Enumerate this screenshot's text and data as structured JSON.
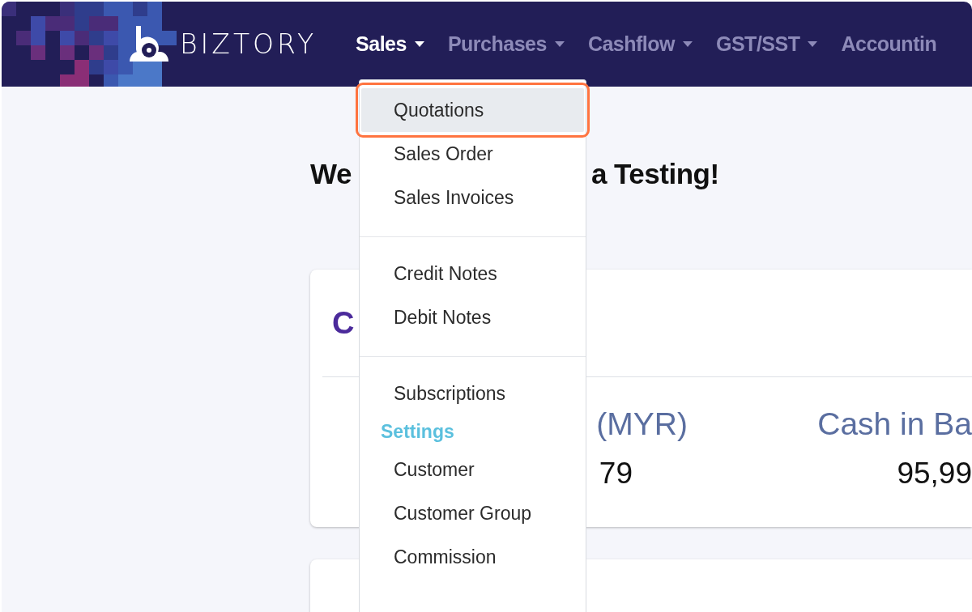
{
  "brand": {
    "name": "BIZTORY"
  },
  "nav": [
    {
      "label": "Sales",
      "selected": true,
      "has_caret": true
    },
    {
      "label": "Purchases",
      "selected": false,
      "has_caret": true
    },
    {
      "label": "Cashflow",
      "selected": false,
      "has_caret": true
    },
    {
      "label": "GST/SST",
      "selected": false,
      "has_caret": true
    },
    {
      "label": "Accountin",
      "selected": false,
      "has_caret": false
    }
  ],
  "welcome": {
    "start": "We",
    "end": "a Testing!"
  },
  "card": {
    "title": "C",
    "stats": [
      {
        "label": "(MYR)",
        "value": "79"
      },
      {
        "label": "Cash in Ba",
        "value": "95,99"
      }
    ]
  },
  "dropdown": [
    {
      "kind": "item",
      "label": "Quotations",
      "selected": true
    },
    {
      "kind": "item",
      "label": "Sales Order",
      "selected": false
    },
    {
      "kind": "item",
      "label": "Sales Invoices",
      "selected": false
    },
    {
      "kind": "divider"
    },
    {
      "kind": "item",
      "label": "Credit Notes",
      "selected": false
    },
    {
      "kind": "item",
      "label": "Debit Notes",
      "selected": false
    },
    {
      "kind": "divider"
    },
    {
      "kind": "item",
      "label": "Subscriptions",
      "selected": false
    },
    {
      "kind": "header",
      "label": "Settings"
    },
    {
      "kind": "item",
      "label": "Customer",
      "selected": false
    },
    {
      "kind": "item",
      "label": "Customer Group",
      "selected": false
    },
    {
      "kind": "item",
      "label": "Commission",
      "selected": false
    }
  ]
}
